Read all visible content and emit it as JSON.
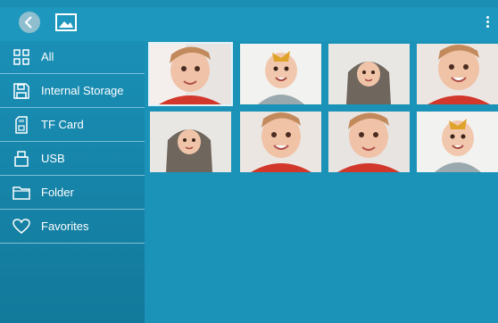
{
  "topbar": {
    "back_icon": "chevron-left-icon",
    "gallery_icon": "image-icon",
    "menu_icon": "more-vertical-icon"
  },
  "sidebar": {
    "items": [
      {
        "label": "All",
        "icon": "grid-icon"
      },
      {
        "label": "Internal Storage",
        "icon": "save-icon"
      },
      {
        "label": "TF Card",
        "icon": "sd-card-icon"
      },
      {
        "label": "USB",
        "icon": "usb-icon"
      },
      {
        "label": "Folder",
        "icon": "folder-icon"
      },
      {
        "label": "Favorites",
        "icon": "heart-icon"
      }
    ]
  },
  "colors": {
    "topbar": "#1d97bd",
    "sidebar": "#1a8fb6",
    "content": "#1b92b7",
    "divider": "#7cc0d7"
  },
  "photos": [
    {
      "kind": "baby-red",
      "selected": true
    },
    {
      "kind": "baby-bow",
      "selected": false
    },
    {
      "kind": "baby-hoodie",
      "selected": false
    },
    {
      "kind": "baby-red",
      "selected": false
    },
    {
      "kind": "baby-hoodie",
      "selected": false
    },
    {
      "kind": "baby-red",
      "selected": false
    },
    {
      "kind": "baby-red",
      "selected": false
    },
    {
      "kind": "baby-bow",
      "selected": false
    }
  ]
}
